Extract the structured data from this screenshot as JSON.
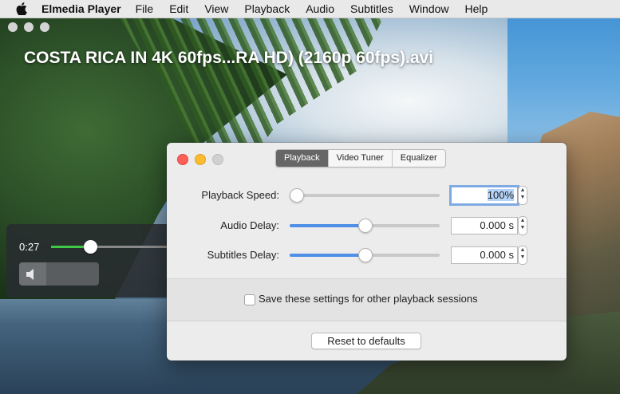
{
  "menubar": {
    "app_name": "Elmedia Player",
    "items": [
      "File",
      "Edit",
      "View",
      "Playback",
      "Audio",
      "Subtitles",
      "Window",
      "Help"
    ]
  },
  "player": {
    "title": "COSTA RICA IN 4K 60fps...RA HD) (2160p 60fps).avi",
    "current_time": "0:27",
    "progress_fraction": 0.32,
    "volume_fraction": 0.34
  },
  "dialog": {
    "tabs": [
      "Playback",
      "Video Tuner",
      "Equalizer"
    ],
    "active_tab": "Playback",
    "rows": [
      {
        "label": "Playback Speed:",
        "value": "100%",
        "slider_fraction": 0.0
      },
      {
        "label": "Audio Delay:",
        "value": "0.000 s",
        "slider_fraction": 0.5
      },
      {
        "label": "Subtitles Delay:",
        "value": "0.000 s",
        "slider_fraction": 0.5
      }
    ],
    "save_checkbox_label": "Save these settings for other playback sessions",
    "save_checked": false,
    "reset_label": "Reset to defaults"
  },
  "colors": {
    "accent_blue": "#4e8fe7",
    "progress_green": "#3ec846",
    "close_red": "#fc5f57",
    "minimize_yellow": "#fdbb2e"
  },
  "icons": [
    "apple-icon",
    "speaker-icon",
    "stepper-arrows-icon"
  ]
}
